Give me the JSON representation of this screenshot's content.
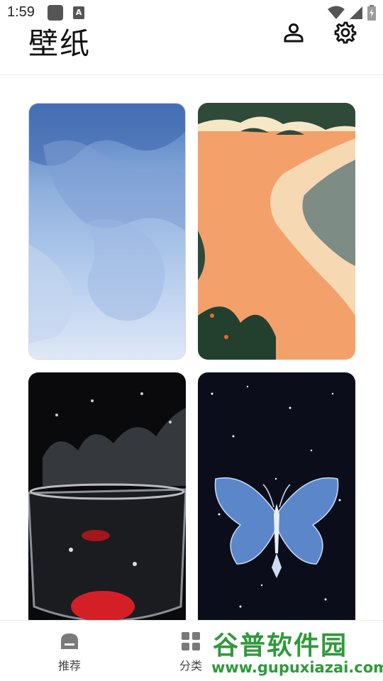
{
  "status_bar": {
    "time": "1:59",
    "app_badge": "A",
    "icons": [
      "wifi-icon",
      "signal-icon",
      "battery-charging-icon"
    ]
  },
  "header": {
    "title": "壁纸",
    "actions": [
      {
        "name": "profile-icon"
      },
      {
        "name": "gear-icon"
      }
    ]
  },
  "wallpapers": [
    {
      "name": "blue-watercolor-wallpaper"
    },
    {
      "name": "beach-shore-wallpaper"
    },
    {
      "name": "water-splash-glass-wallpaper"
    },
    {
      "name": "crystal-butterfly-wallpaper"
    }
  ],
  "bottom_nav": {
    "items": [
      {
        "label": "推荐",
        "icon": "home-icon"
      },
      {
        "label": "分类",
        "icon": "grid-icon"
      }
    ]
  },
  "watermark": {
    "title": "谷普软件园",
    "url": "www.gupuxiazai.com"
  },
  "colors": {
    "watermark_green": "#2e9a3a",
    "nav_icon_gray": "#7a7a7a"
  }
}
